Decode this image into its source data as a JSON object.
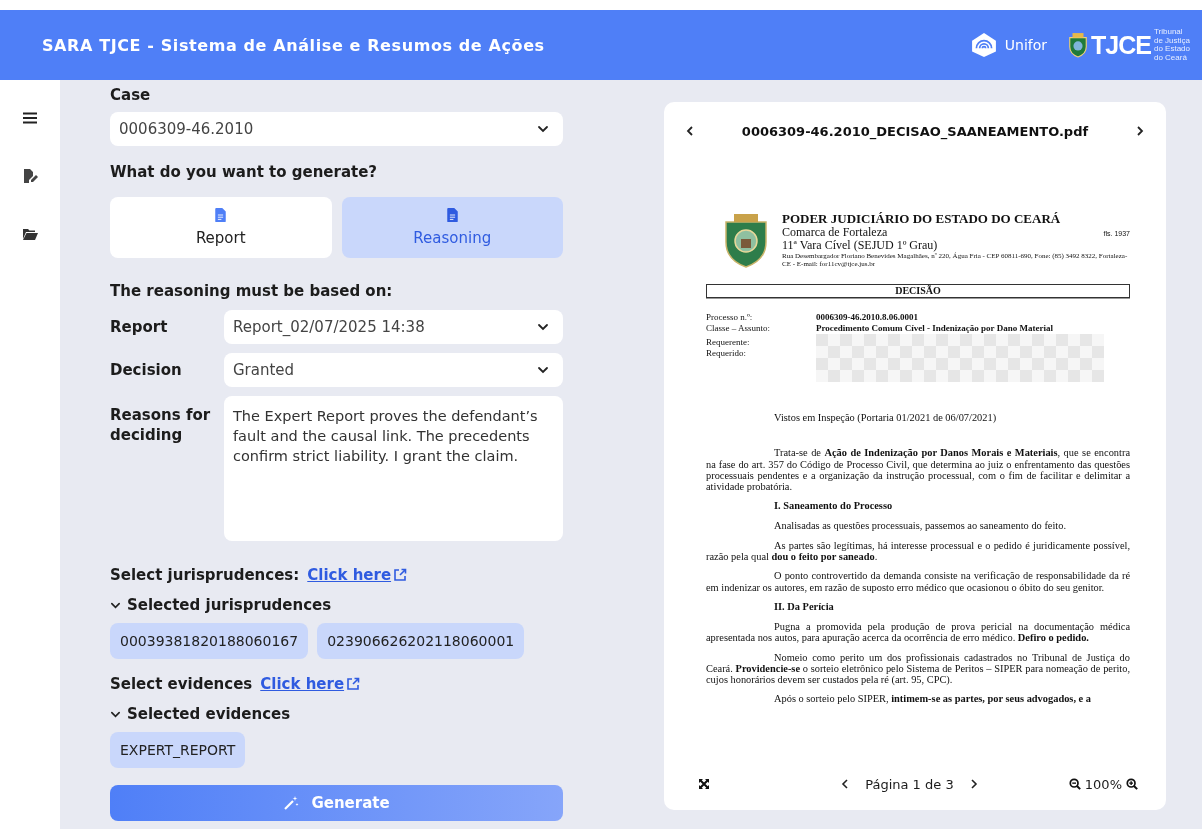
{
  "header": {
    "title": "SARA TJCE - Sistema de Análise e Resumos de Ações",
    "unifor": "Unifor",
    "tjce": {
      "name": "TJCE",
      "lines": [
        "Tribunal",
        "de Justiça",
        "do Estado",
        "do Ceará"
      ]
    }
  },
  "form": {
    "case_label": "Case",
    "case_value": "0006309-46.2010",
    "generate_label": "What do you want to generate?",
    "options": [
      {
        "label": "Report",
        "selected": false
      },
      {
        "label": "Reasoning",
        "selected": true
      }
    ],
    "based_on_label": "The reasoning must be based on:",
    "fields": [
      {
        "kind": "select",
        "label": "Report",
        "value": "Report_02/07/2025 14:38"
      },
      {
        "kind": "select",
        "label": "Decision",
        "value": "Granted"
      },
      {
        "kind": "textarea",
        "label": "Reasons for deciding",
        "value": "The Expert Report proves the defendant’s fault and the causal link. The precedents confirm strict liability. I grant the claim."
      }
    ],
    "groups": [
      {
        "label": "Select jurisprudences:",
        "link": "Click here",
        "heading": "Selected jurisprudences",
        "expanded": true,
        "tags": [
          "00039381820188060167",
          "023906626202118060001"
        ]
      },
      {
        "label": "Select evidences",
        "link": "Click here",
        "heading": "Selected evidences",
        "expanded": true,
        "tags": [
          "EXPERT_REPORT"
        ]
      }
    ],
    "generate": "Generate"
  },
  "viewer": {
    "filename": "0006309-46.2010_DECISAO_SAANEAMENTO.pdf",
    "document": {
      "court": "PODER JUDICIÁRIO DO ESTADO DO CEARÁ",
      "district": "Comarca de Fortaleza",
      "folio": "fls. 1937",
      "court_unit": "11ª Vara Cível (SEJUD 1º Grau)",
      "address": "Rua Desembargador Floriano Benevides Magalhães, nº 220, Água Fria - CEP 60811-690, Fone: (85) 3492 8322, Fortaleza-CE - E-mail: for11cv@tjce.jus.br",
      "heading": "DECISÃO",
      "meta": [
        {
          "label": "Processo n.º:",
          "value": "0006309-46.2010.8.06.0001"
        },
        {
          "label": "Classe – Assunto:",
          "value": "Procedimento Comum Cível - Indenização por Dano Material"
        }
      ],
      "parties": [
        "Requerente:",
        "Requerido:"
      ],
      "body": [
        {
          "kind": "note",
          "text": "Vistos em Inspeção (Portaria 01/2021 de 06/07/2021)"
        },
        {
          "kind": "para",
          "text": "Trata-se de **Ação de Indenização por Danos Morais e Materiais**, que se encontra na fase do art. 357 do Código de Processo Civil, que determina ao juiz o enfrentamento das questões processuais pendentes e a organização da instrução processual, com o fim de facilitar e delimitar a atividade probatória."
        },
        {
          "kind": "heading",
          "text": "I. Saneamento do Processo"
        },
        {
          "kind": "para",
          "text": "Analisadas as questões processuais, passemos ao saneamento do feito."
        },
        {
          "kind": "para",
          "text": "As partes são legítimas, há interesse processual e o pedido é juridicamente possível, razão pela qual **dou o feito por saneado**."
        },
        {
          "kind": "para",
          "text": "O ponto controvertido da demanda consiste na verificação de responsabilidade da ré em indenizar os autores, em razão de suposto erro médico que ocasionou o óbito do seu genitor."
        },
        {
          "kind": "heading",
          "text": "II. Da Perícia"
        },
        {
          "kind": "para",
          "text": "Pugna a promovida pela produção de prova pericial na documentação médica apresentada nos autos, para apuração acerca da ocorrência de erro médico. **Defiro o pedido.**"
        },
        {
          "kind": "para",
          "text": "Nomeio como perito um dos profissionais cadastrados no Tribunal de Justiça do Ceará. **Providencie-se** o sorteio eletrônico pelo Sistema de Peritos – SIPER para nomeação de perito, cujos honorários devem ser custados pela ré (art. 95, CPC)."
        },
        {
          "kind": "para",
          "text": "Após o sorteio pelo SIPER, **intimem-se as partes, por seus advogados, e a**"
        }
      ]
    },
    "page_label": "Página 1 de 3",
    "zoom": "100%"
  }
}
